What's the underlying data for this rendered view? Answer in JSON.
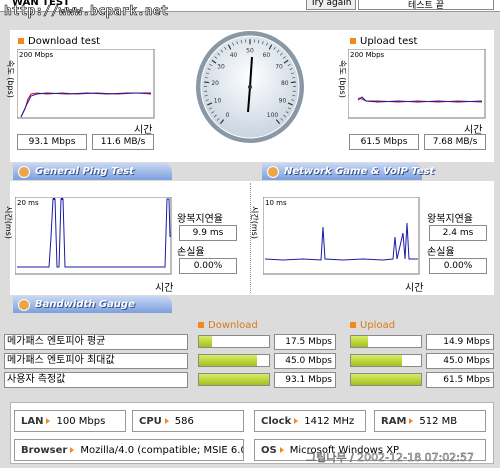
{
  "header": {
    "title": "WAN TEST",
    "watermark": "http://www.bcpark.net",
    "try_again": "Try again",
    "test_label": "테스트 끝"
  },
  "download": {
    "title": "Download test",
    "scale": "200 Mbps",
    "axis_y": "속도 (bps)",
    "axis_x": "시간",
    "mbps": "93.1 Mbps",
    "mbs": "11.6 MB/s"
  },
  "upload": {
    "title": "Upload test",
    "scale": "200 Mbps",
    "axis_y": "속도 (bps)",
    "axis_x": "시간",
    "mbps": "61.5 Mbps",
    "mbs": "7.68 MB/s"
  },
  "gauge": {
    "ticks": [
      "0",
      "10",
      "20",
      "30",
      "40",
      "50",
      "60",
      "70",
      "80",
      "90",
      "100"
    ],
    "value": "93.1"
  },
  "ping": {
    "tab": "General Ping Test",
    "scale": "20 ms",
    "axis_y": "시간(ms)",
    "axis_x": "시간",
    "rtt_label": "왕복지연율",
    "rtt": "9.9 ms",
    "loss_label": "손실율",
    "loss": "0.00%"
  },
  "game": {
    "tab": "Network Game & VoIP Test",
    "scale": "10 ms",
    "axis_y": "시간(ms)",
    "axis_x": "시간",
    "rtt_label": "왕복지연율",
    "rtt": "2.4 ms",
    "loss_label": "손실율",
    "loss": "0.00%"
  },
  "bandwidth": {
    "tab": "Bandwidth Gauge",
    "download_label": "Download",
    "upload_label": "Upload",
    "rows": [
      {
        "label": "메가패스 엔토피아 평균",
        "down": "17.5 Mbps",
        "down_frac": 0.19,
        "up": "14.9 Mbps",
        "up_frac": 0.24
      },
      {
        "label": "메가패스 엔토피아 최대값",
        "down": "45.0 Mbps",
        "down_frac": 0.83,
        "up": "45.0 Mbps",
        "up_frac": 0.73
      },
      {
        "label": "사용자 측정값",
        "down": "93.1 Mbps",
        "down_frac": 1.0,
        "up": "61.5 Mbps",
        "up_frac": 1.0
      }
    ]
  },
  "sysinfo": {
    "lan_label": "LAN",
    "lan": "100 Mbps",
    "cpu_label": "CPU",
    "cpu": "586",
    "clock_label": "Clock",
    "clock": "1412 MHz",
    "ram_label": "RAM",
    "ram": "512 MB",
    "browser_label": "Browser",
    "browser": "Mozilla/4.0 (compatible; MSIE 6.0",
    "os_label": "OS",
    "os": "Microsoft Windows XP"
  },
  "footer": {
    "credit": "그림나무 / 2002-12-18 07:02:57"
  },
  "colors": {
    "tab_blue": "#7d9fde",
    "accent_orange": "#f08a1c",
    "bar_green": "#a2c11b",
    "line_blue": "#1a1aa8",
    "line_red": "#d01010"
  }
}
